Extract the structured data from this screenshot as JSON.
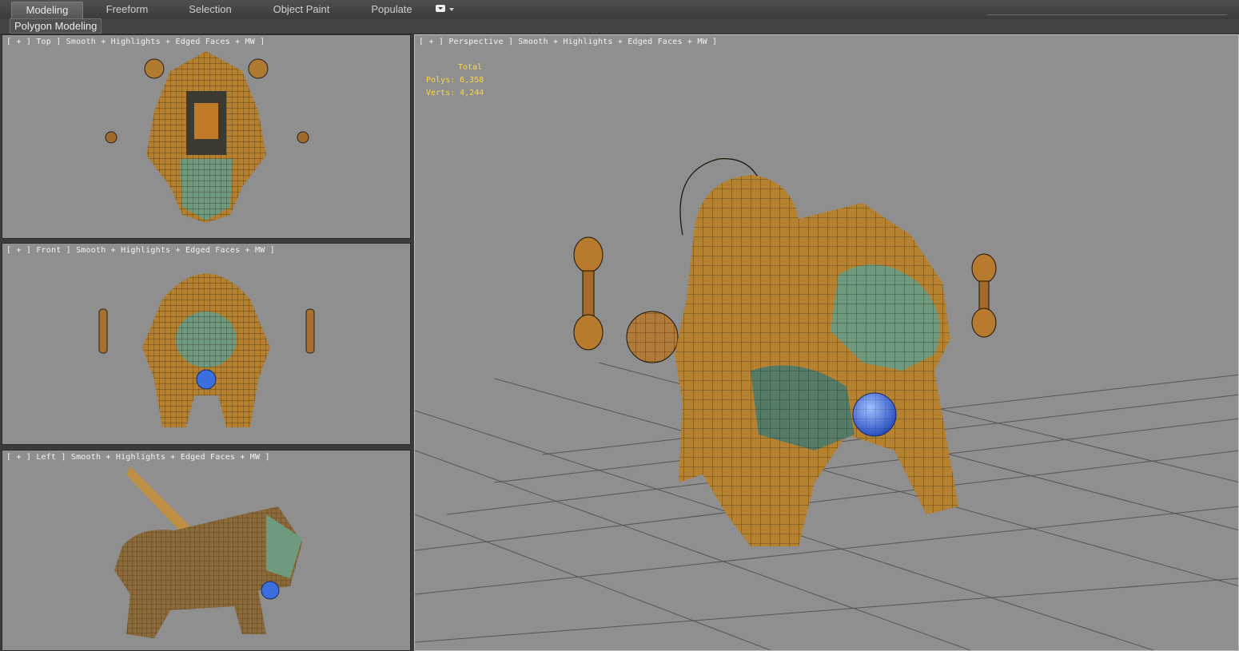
{
  "ribbon": {
    "tabs": [
      {
        "label": "Modeling",
        "active": true
      },
      {
        "label": "Freeform",
        "active": false
      },
      {
        "label": "Selection",
        "active": false
      },
      {
        "label": "Object Paint",
        "active": false
      },
      {
        "label": "Populate",
        "active": false
      }
    ],
    "menu_icon": "dropdown-icon"
  },
  "subbar": {
    "panel_label": "Polygon Modeling"
  },
  "viewports": {
    "top": {
      "label": "[ + ] Top ] Smooth + Highlights + Edged Faces + MW ]"
    },
    "front": {
      "label": "[ + ] Front ] Smooth + Highlights + Edged Faces + MW ]"
    },
    "left": {
      "label": "[ + ] Left ] Smooth + Highlights + Edged Faces + MW ]"
    },
    "perspective": {
      "label": "[ + ] Perspective ] Smooth + Highlights + Edged Faces + MW ]"
    }
  },
  "stats": {
    "header": "Total",
    "polys": "Polys: 6,358",
    "verts": "Verts: 4,244"
  },
  "colors": {
    "viewport_bg": "#8f8f8f",
    "stats_text": "#ffd83a",
    "gold": "#c98f2e",
    "jade": "#5f8a74",
    "orb_blue": "#3b6fe0",
    "wire": "#1a1206"
  }
}
